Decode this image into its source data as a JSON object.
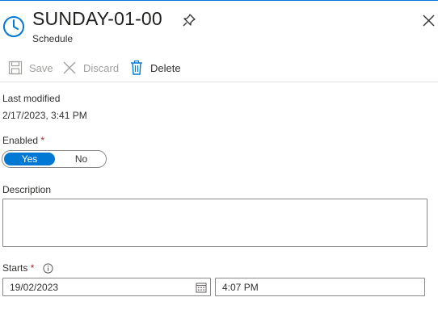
{
  "header": {
    "title": "SUNDAY-01-00",
    "subtitle": "Schedule"
  },
  "toolbar": {
    "save_label": "Save",
    "discard_label": "Discard",
    "delete_label": "Delete"
  },
  "last_modified": {
    "label": "Last modified",
    "value": "2/17/2023, 3:41 PM"
  },
  "enabled": {
    "label": "Enabled",
    "required_marker": "*",
    "options": [
      "Yes",
      "No"
    ],
    "selected": "Yes"
  },
  "description": {
    "label": "Description",
    "value": ""
  },
  "starts": {
    "label": "Starts",
    "required_marker": "*",
    "date": "19/02/2023",
    "time": "4:07 PM"
  },
  "icons": {
    "header": "clock-icon",
    "pin": "pin-icon",
    "close": "close-icon",
    "save": "save-icon",
    "discard": "discard-icon",
    "delete": "delete-icon",
    "info": "info-icon",
    "calendar": "calendar-icon"
  },
  "colors": {
    "accent": "#0078d4",
    "required": "#a4262c",
    "disabled_text": "#a19f9d",
    "border": "#8a8886"
  }
}
